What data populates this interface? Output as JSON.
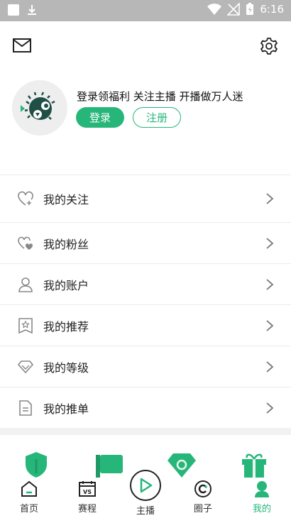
{
  "status_bar": {
    "time": "6:16",
    "colors": {
      "bg": "#b7b7b7"
    }
  },
  "header": {
    "mail_icon": "mail-icon",
    "settings_icon": "gear-icon"
  },
  "profile": {
    "promo_text": "登录领福利 关注主播 开播做万人迷",
    "login_label": "登录",
    "register_label": "注册",
    "avatar_icon": "pufferfish-avatar"
  },
  "menu": {
    "items": [
      {
        "label": "我的关注",
        "icon": "heart-plus-icon"
      },
      {
        "label": "我的粉丝",
        "icon": "hearts-icon"
      },
      {
        "label": "我的账户",
        "icon": "user-icon"
      },
      {
        "label": "我的推荐",
        "icon": "star-bookmark-icon"
      },
      {
        "label": "我的等级",
        "icon": "diamond-icon"
      },
      {
        "label": "我的推单",
        "icon": "document-icon"
      }
    ]
  },
  "tabbar": {
    "tabs": [
      {
        "label": "首页",
        "icon": "home-icon"
      },
      {
        "label": "赛程",
        "icon": "vs-calendar-icon"
      },
      {
        "label": "主播",
        "icon": "play-icon"
      },
      {
        "label": "圈子",
        "icon": "circle-icon"
      },
      {
        "label": "我的",
        "icon": "profile-icon"
      }
    ],
    "active_index": 4
  },
  "colors": {
    "accent": "#27b67a",
    "divider": "#ececec"
  }
}
